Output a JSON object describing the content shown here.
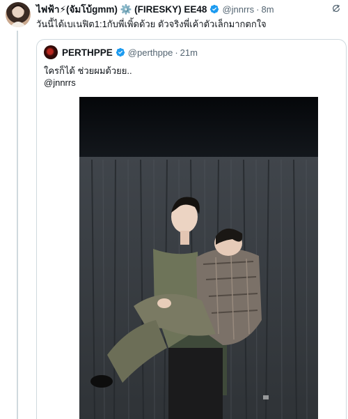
{
  "tweet": {
    "author_name": "ไฟฟ้า⚡(จัมโบ้gmm) ⚙️ (FIRESKY) EE48",
    "handle": "@jnnrrs",
    "separator": "·",
    "time": "8m",
    "text": "วันนี้ได้เบเนฟิต1:1กับพี่เพิ้ดด้วย ตัวจริงพี่เค้าตัวเล็กมากตกใจ",
    "verified": true,
    "top_right_icon": "cache-icon"
  },
  "quoted_tweet": {
    "author_name": "PERTHPPE",
    "handle": "@perthppe",
    "separator": "·",
    "time": "21m",
    "text_line1": "ใครก็ได้ ช่วยผมด้วยย..",
    "text_line2": "@jnnrrs",
    "verified": true,
    "media_alt": "photo"
  },
  "colors": {
    "text": "#0f1419",
    "secondary": "#536471",
    "verified": "#1d9bf0",
    "border": "#cfd9de",
    "curtain": "#363a3f"
  }
}
